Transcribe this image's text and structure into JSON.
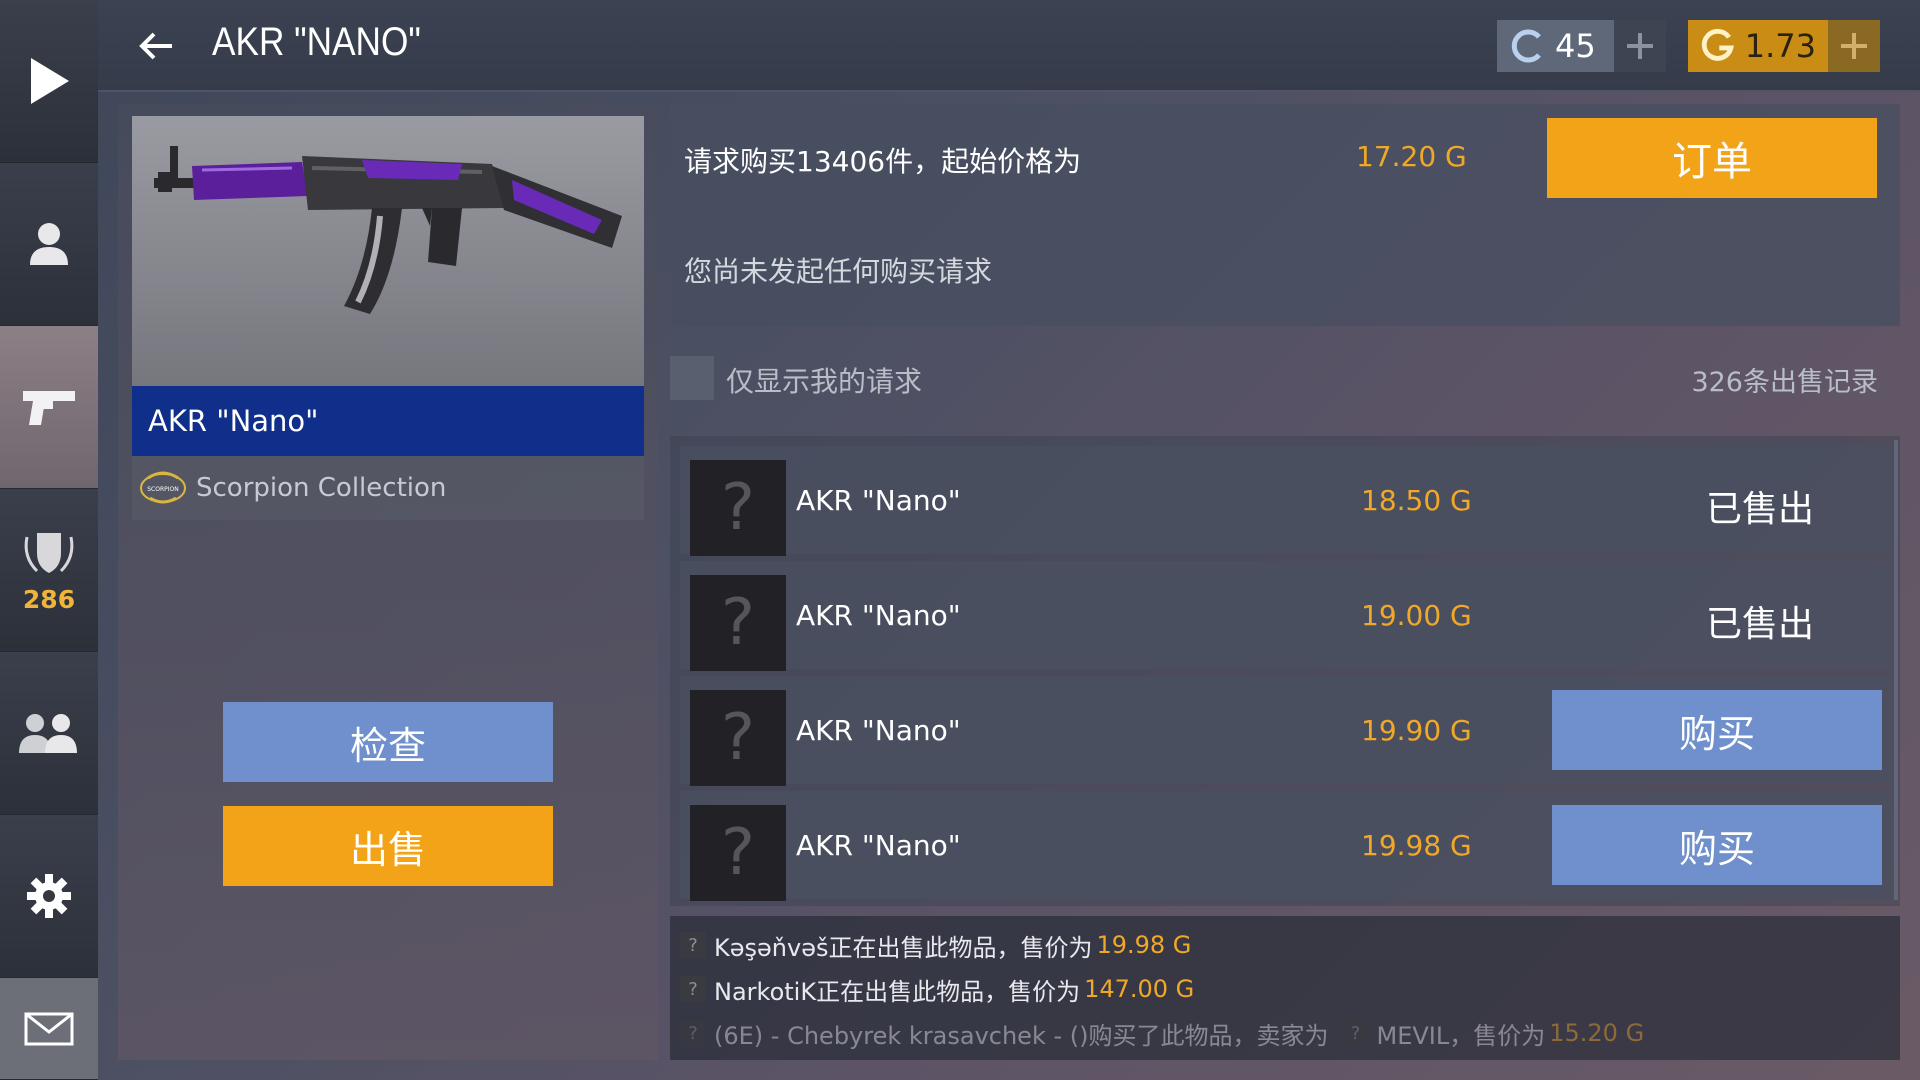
{
  "header": {
    "title": "AKR \"NANO\"",
    "silver_amount": "45",
    "gold_amount": "1.73"
  },
  "nav": {
    "rank_value": "286"
  },
  "item": {
    "name": "AKR \"Nano\"",
    "collection": "Scorpion Collection",
    "collection_logo_text": "SCORPION",
    "inspect_label": "检查",
    "sell_label": "出售"
  },
  "order": {
    "request_text": "请求购买13406件，起始价格为",
    "start_price": "17.20 G",
    "order_button": "订单",
    "no_request_text": "您尚未发起任何购买请求"
  },
  "filter": {
    "only_mine_label": "仅显示我的请求",
    "records_count": "326条出售记录"
  },
  "listings": [
    {
      "name": "AKR \"Nano\"",
      "price": "18.50 G",
      "status": "已售出",
      "action": "",
      "thumb": "?"
    },
    {
      "name": "AKR \"Nano\"",
      "price": "19.00 G",
      "status": "已售出",
      "action": "",
      "thumb": "?"
    },
    {
      "name": "AKR \"Nano\"",
      "price": "19.90 G",
      "status": "",
      "action": "购买",
      "thumb": "?"
    },
    {
      "name": "AKR \"Nano\"",
      "price": "19.98 G",
      "status": "",
      "action": "购买",
      "thumb": "?"
    }
  ],
  "feed": [
    {
      "q": "?",
      "text": "Kəşəňvəš正在出售此物品，售价为",
      "price": "19.98 G"
    },
    {
      "q": "?",
      "text": "NarkotiK正在出售此物品，售价为",
      "price": "147.00 G"
    },
    {
      "q": "?",
      "text": "(6E) - Chebyrek krasavchek - ()购买了此物品，卖家为",
      "q2": "?",
      "seller": "MEVIL，售价为",
      "price": "15.20 G"
    }
  ],
  "colors": {
    "gold_accent": "#f3a317",
    "blue_button": "#6f90cc",
    "name_bar": "#0f2f8a",
    "price_text": "#f0a828"
  },
  "icons": {
    "nav": [
      "play-icon",
      "profile-icon",
      "pistol-icon",
      "rank-shield-icon",
      "friends-icon",
      "gear-icon",
      "mail-icon"
    ],
    "header": [
      "back-arrow-icon",
      "silver-coin-icon",
      "gold-coin-icon",
      "plus-icon"
    ]
  }
}
